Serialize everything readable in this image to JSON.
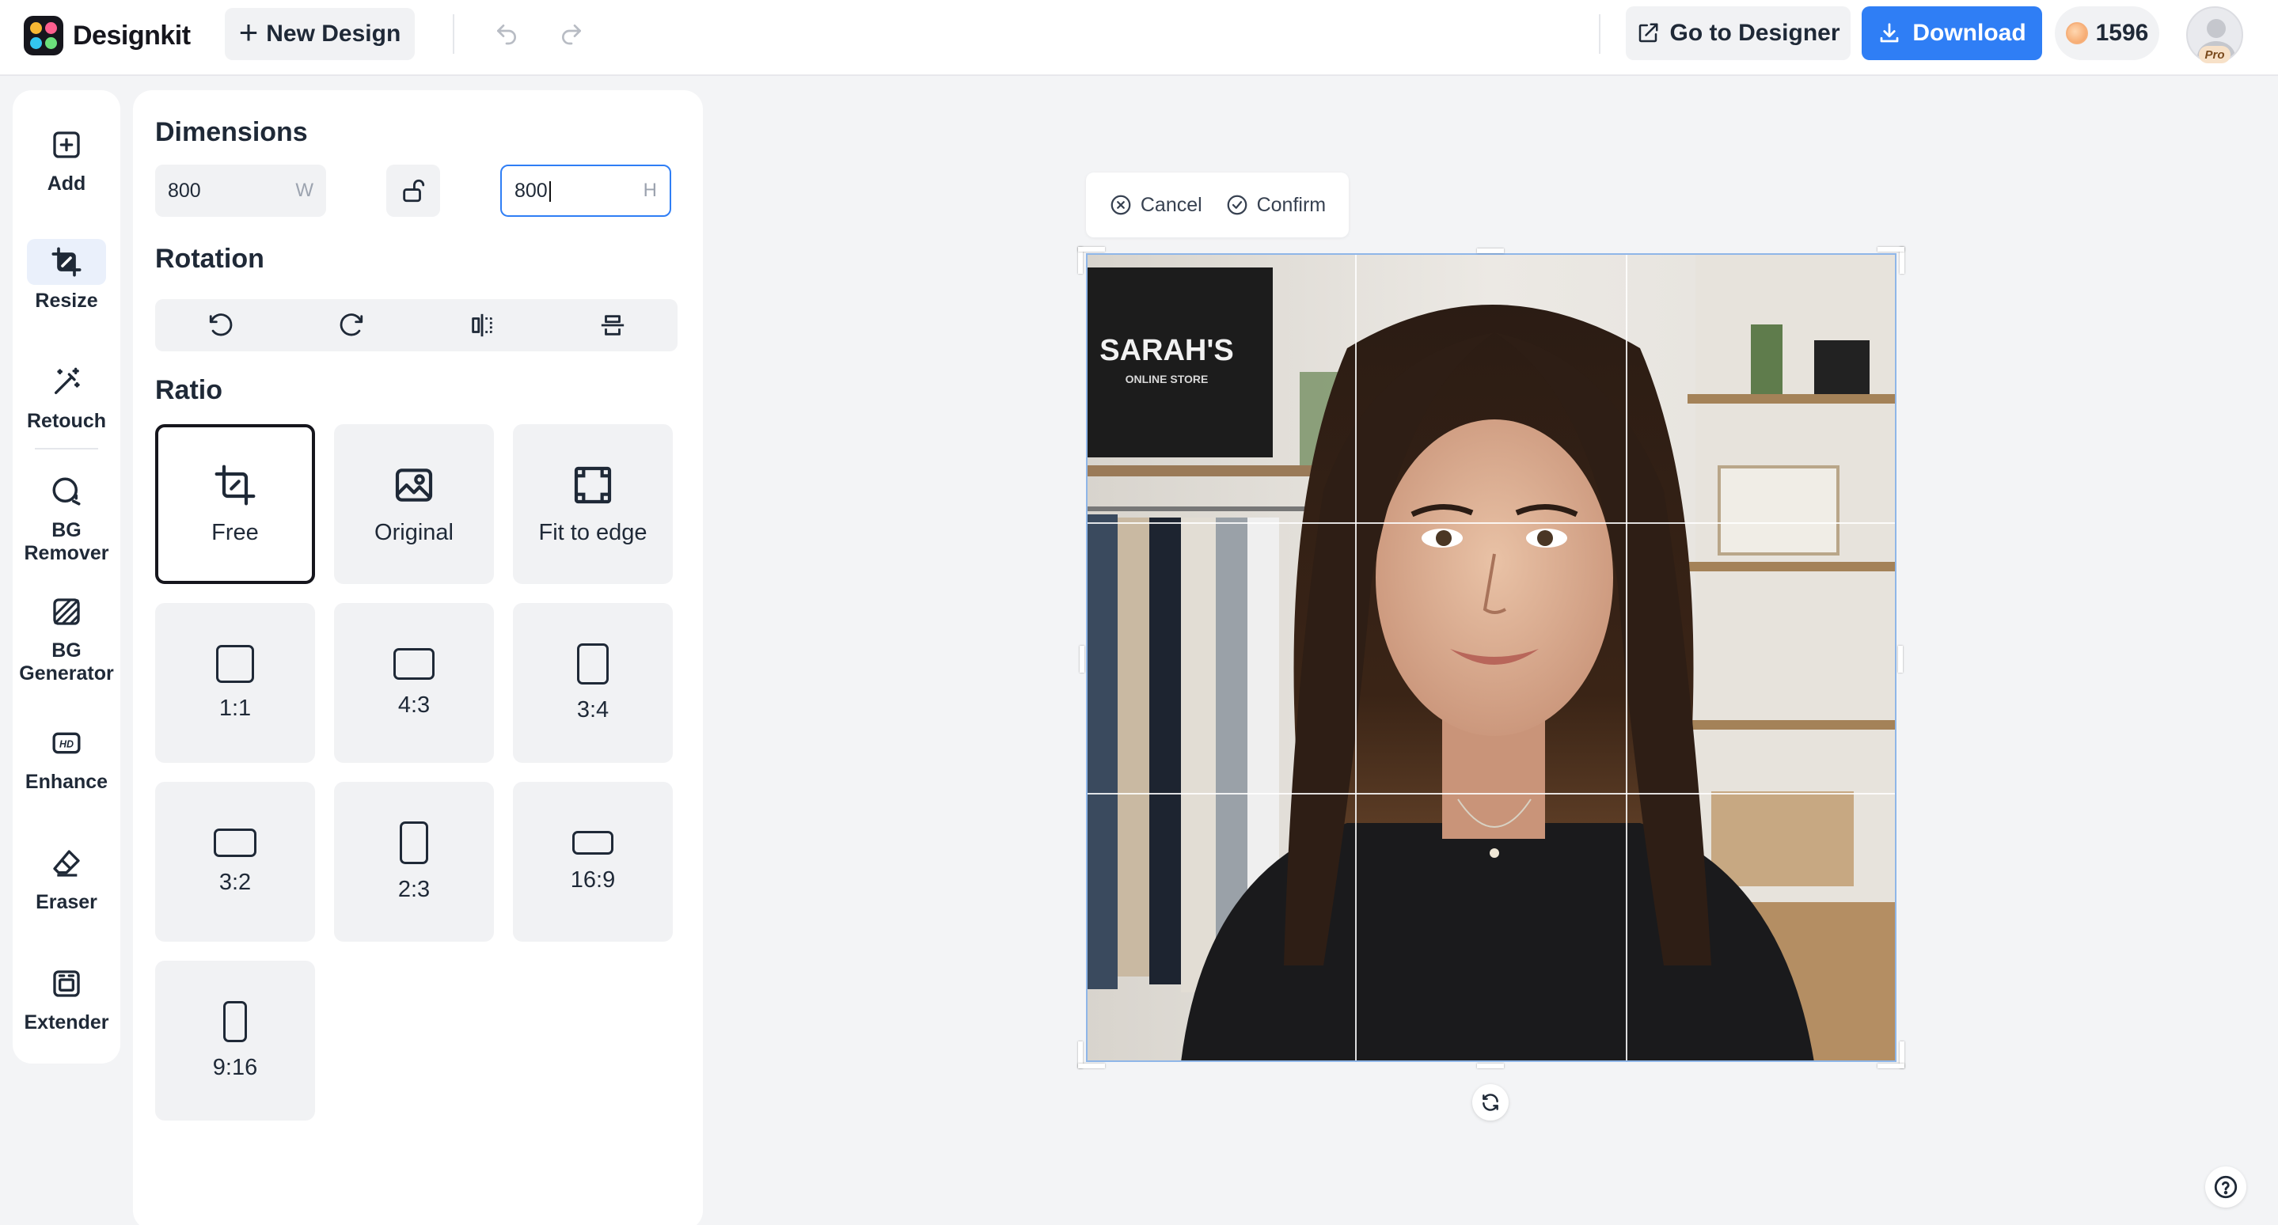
{
  "app": {
    "name": "Designkit"
  },
  "topbar": {
    "new_design_label": "New Design",
    "go_to_designer_label": "Go to Designer",
    "download_label": "Download",
    "credits": "1596",
    "plan_badge": "Pro"
  },
  "sidebar": {
    "items": [
      {
        "label": "Add",
        "icon": "plus-square-icon"
      },
      {
        "label": "Resize",
        "icon": "crop-icon",
        "active": true
      },
      {
        "label": "Retouch",
        "icon": "magic-wand-icon"
      },
      {
        "label": "BG Remover",
        "icon": "bg-remover-icon"
      },
      {
        "label": "BG Generator",
        "icon": "bg-generator-icon"
      },
      {
        "label": "Enhance",
        "icon": "hd-icon"
      },
      {
        "label": "Eraser",
        "icon": "eraser-icon"
      },
      {
        "label": "Extender",
        "icon": "extender-icon"
      }
    ]
  },
  "panel": {
    "dimensions": {
      "title": "Dimensions",
      "width_value": "800",
      "width_unit": "W",
      "height_value": "800",
      "height_unit": "H"
    },
    "rotation": {
      "title": "Rotation",
      "buttons": [
        "rotate-left-icon",
        "rotate-right-icon",
        "flip-horizontal-icon",
        "flip-vertical-icon"
      ]
    },
    "ratio": {
      "title": "Ratio",
      "options": [
        {
          "label": "Free",
          "selected": true
        },
        {
          "label": "Original"
        },
        {
          "label": "Fit to edge"
        },
        {
          "label": "1:1"
        },
        {
          "label": "4:3"
        },
        {
          "label": "3:4"
        },
        {
          "label": "3:2"
        },
        {
          "label": "2:3"
        },
        {
          "label": "16:9"
        },
        {
          "label": "9:16"
        }
      ]
    }
  },
  "canvas": {
    "cancel_label": "Cancel",
    "confirm_label": "Confirm",
    "photo": {
      "sign_title": "SARAH'S",
      "sign_subtitle": "ONLINE STORE"
    }
  },
  "colors": {
    "accent": "#2f7ef5",
    "background": "#f3f4f6",
    "panel": "#ffffff"
  }
}
